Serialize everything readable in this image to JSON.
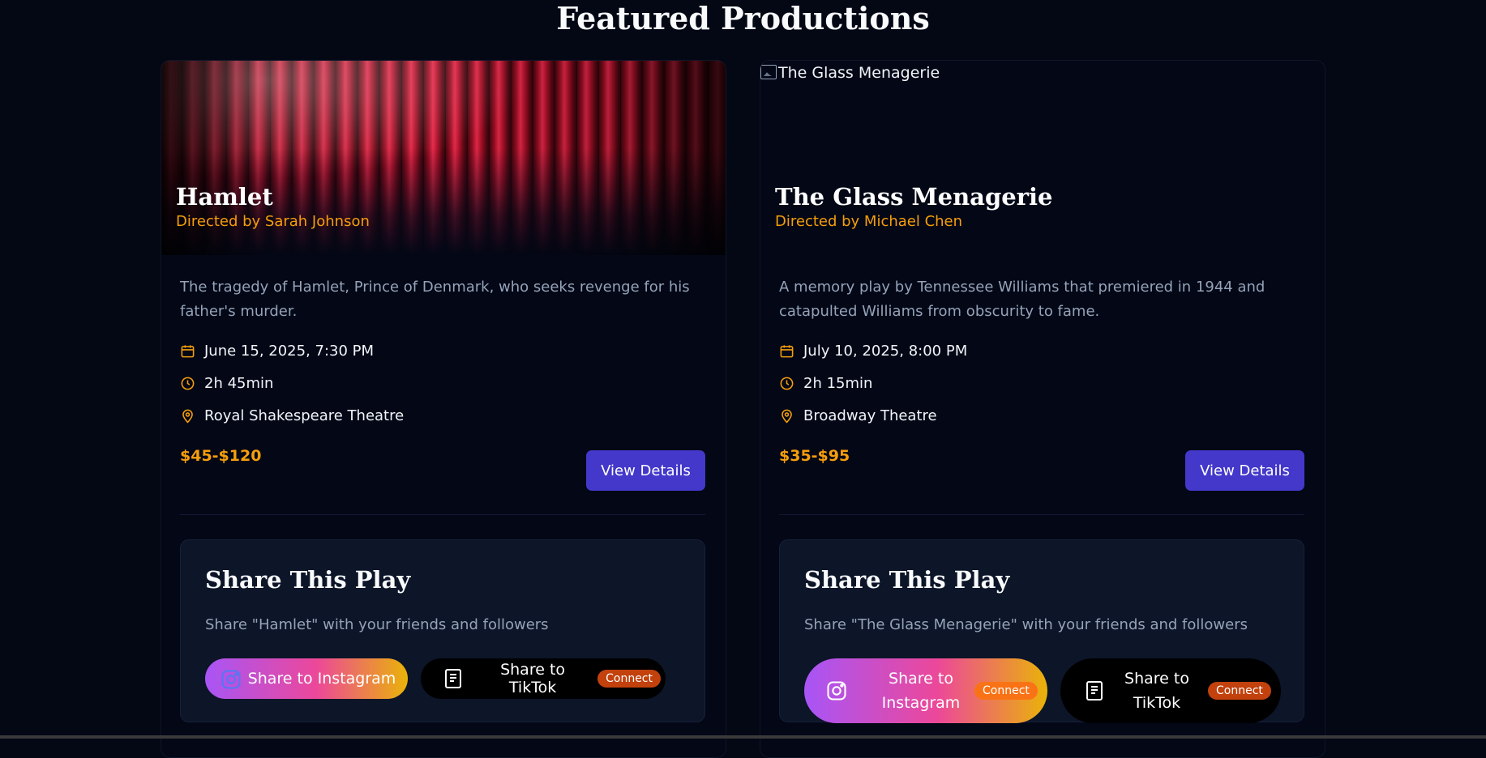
{
  "page": {
    "title": "Featured Productions"
  },
  "colors": {
    "background": "#040714",
    "accent": "#f59e0b",
    "button": "#4338ca",
    "panel": "#0d1528"
  },
  "icons": {
    "date": "calendar-icon",
    "duration": "clock-icon",
    "venue": "map-pin-icon",
    "instagram": "instagram-icon",
    "tiktok": "document-icon"
  },
  "productions": [
    {
      "image_alt": "",
      "title": "Hamlet",
      "director": "Directed by Sarah Johnson",
      "description": "The tragedy of Hamlet, Prince of Denmark, who seeks revenge for his father's murder.",
      "date": "June 15, 2025, 7:30 PM",
      "duration": "2h 45min",
      "venue": "Royal Shakespeare Theatre",
      "price": "$45-$120",
      "view_label": "View Details",
      "share": {
        "title": "Share This Play",
        "subtitle": "Share \"Hamlet\" with your friends and followers",
        "instagram_label": "Share to Instagram",
        "tiktok_label": "Share to TikTok",
        "connect_label": "Connect"
      }
    },
    {
      "image_alt": "The Glass Menagerie",
      "title": "The Glass Menagerie",
      "director": "Directed by Michael Chen",
      "description": "A memory play by Tennessee Williams that premiered in 1944 and catapulted Williams from obscurity to fame.",
      "date": "July 10, 2025, 8:00 PM",
      "duration": "2h 15min",
      "venue": "Broadway Theatre",
      "price": "$35-$95",
      "view_label": "View Details",
      "share": {
        "title": "Share This Play",
        "subtitle": "Share \"The Glass Menagerie\" with your friends and followers",
        "instagram_label": "Share to Instagram",
        "tiktok_label": "Share to TikTok",
        "connect_label": "Connect"
      }
    }
  ]
}
